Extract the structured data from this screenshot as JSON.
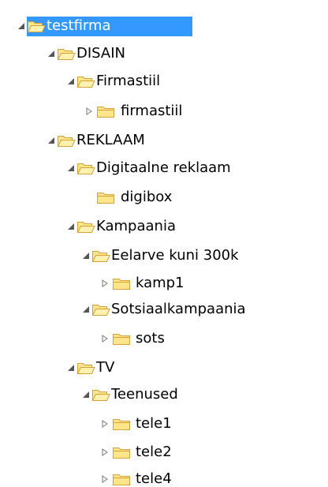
{
  "tree": {
    "nodes": [
      {
        "label": "testfirma",
        "expander": "expanded",
        "open": true,
        "selected": true
      },
      {
        "label": "DISAIN",
        "expander": "expanded",
        "open": true
      },
      {
        "label": "Firmastiil",
        "expander": "expanded",
        "open": true
      },
      {
        "label": "firmastiil",
        "expander": "collapsed",
        "open": false
      },
      {
        "label": "REKLAAM",
        "expander": "expanded",
        "open": true
      },
      {
        "label": "Digitaalne reklaam",
        "expander": "expanded",
        "open": true
      },
      {
        "label": "digibox",
        "expander": "none",
        "open": false
      },
      {
        "label": "Kampaania",
        "expander": "expanded",
        "open": true
      },
      {
        "label": "Eelarve kuni 300k",
        "expander": "expanded",
        "open": true
      },
      {
        "label": "kamp1",
        "expander": "collapsed",
        "open": false
      },
      {
        "label": "Sotsiaalkampaania",
        "expander": "expanded",
        "open": true
      },
      {
        "label": "sots",
        "expander": "collapsed",
        "open": false
      },
      {
        "label": "TV",
        "expander": "expanded",
        "open": true
      },
      {
        "label": "Teenused",
        "expander": "expanded",
        "open": true
      },
      {
        "label": "tele1",
        "expander": "collapsed",
        "open": false
      },
      {
        "label": "tele2",
        "expander": "collapsed",
        "open": false
      },
      {
        "label": "tele4",
        "expander": "collapsed",
        "open": false
      }
    ]
  },
  "colors": {
    "selection": "#3399ff",
    "folder_fill": "#fce58a",
    "folder_stroke": "#d3a23b",
    "expander": "#555555"
  }
}
